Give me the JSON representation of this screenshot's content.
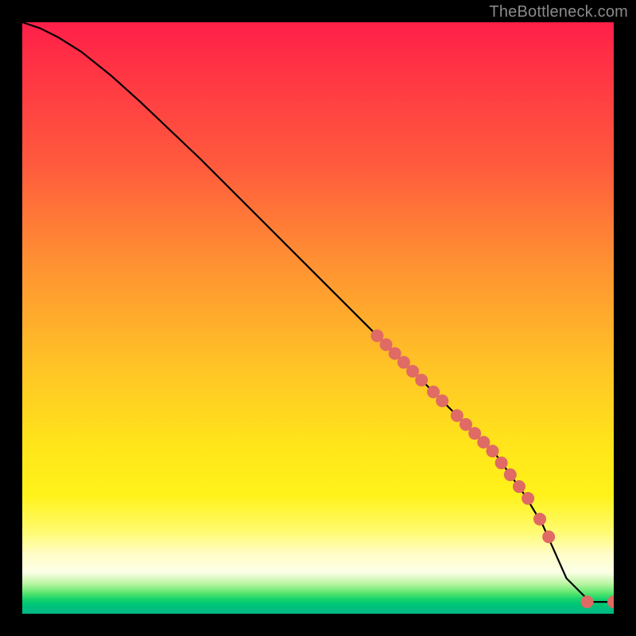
{
  "attribution": "TheBottleneck.com",
  "chart_data": {
    "type": "line",
    "title": "",
    "xlabel": "",
    "ylabel": "",
    "xlim": [
      0,
      100
    ],
    "ylim": [
      0,
      100
    ],
    "curve": {
      "name": "bottleneck-curve",
      "x": [
        0,
        3,
        6,
        10,
        15,
        20,
        30,
        40,
        50,
        60,
        70,
        80,
        85,
        88,
        92,
        96,
        100
      ],
      "y": [
        100,
        99,
        97.5,
        95,
        91,
        86.5,
        77,
        67,
        57,
        47,
        37,
        27,
        20,
        15,
        6,
        2,
        2
      ]
    },
    "marker_series": {
      "name": "highlighted-points",
      "color": "#e06a64",
      "radius": 8,
      "points": [
        {
          "x": 60.0,
          "y": 47.0
        },
        {
          "x": 61.5,
          "y": 45.5
        },
        {
          "x": 63.0,
          "y": 44.0
        },
        {
          "x": 64.5,
          "y": 42.5
        },
        {
          "x": 66.0,
          "y": 41.0
        },
        {
          "x": 67.5,
          "y": 39.5
        },
        {
          "x": 69.5,
          "y": 37.5
        },
        {
          "x": 71.0,
          "y": 36.0
        },
        {
          "x": 73.5,
          "y": 33.5
        },
        {
          "x": 75.0,
          "y": 32.0
        },
        {
          "x": 76.5,
          "y": 30.5
        },
        {
          "x": 78.0,
          "y": 29.0
        },
        {
          "x": 79.5,
          "y": 27.5
        },
        {
          "x": 81.0,
          "y": 25.5
        },
        {
          "x": 82.5,
          "y": 23.5
        },
        {
          "x": 84.0,
          "y": 21.5
        },
        {
          "x": 85.5,
          "y": 19.5
        },
        {
          "x": 87.5,
          "y": 16.0
        },
        {
          "x": 89.0,
          "y": 13.0
        },
        {
          "x": 95.5,
          "y": 2.0
        },
        {
          "x": 100.0,
          "y": 2.0
        }
      ]
    }
  }
}
